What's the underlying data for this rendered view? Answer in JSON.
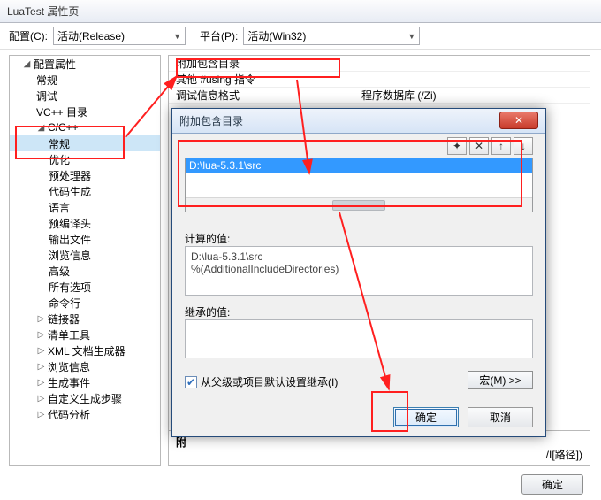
{
  "window": {
    "title": "LuaTest 属性页"
  },
  "config": {
    "label_config": "配置(C):",
    "value_config": "活动(Release)",
    "label_platform": "平台(P):",
    "value_platform": "活动(Win32)"
  },
  "tree": {
    "root": "配置属性",
    "items_lvl2": [
      "常规",
      "调试",
      "VC++ 目录"
    ],
    "cc_root": "C/C++",
    "cc_items": [
      "常规",
      "优化",
      "预处理器",
      "代码生成",
      "语言",
      "预编译头",
      "输出文件",
      "浏览信息",
      "高级",
      "所有选项",
      "命令行"
    ],
    "rest": [
      "链接器",
      "清单工具",
      "XML 文档生成器",
      "浏览信息",
      "生成事件",
      "自定义生成步骤",
      "代码分析"
    ]
  },
  "props": {
    "row1_k": "附加包含目录",
    "row2_k": "其他 #using 指令",
    "row3_k": "调试信息格式",
    "row3_v": "程序数据库 (/Zi)",
    "hint_prefix": "附",
    "hint_suffix": "/I[路径])",
    "btn_ok": "确定"
  },
  "dialog": {
    "title": "附加包含目录",
    "list_selected": "D:\\lua-5.3.1\\src",
    "calc_label": "计算的值:",
    "calc_line1": "D:\\lua-5.3.1\\src",
    "calc_line2": "%(AdditionalIncludeDirectories)",
    "inherit_label": "继承的值:",
    "checkbox_label": "从父级或项目默认设置继承(I)",
    "macro_btn": "宏(M) >>",
    "ok": "确定",
    "cancel": "取消",
    "tool_new": "✦",
    "tool_del": "✕",
    "tool_up": "↑",
    "tool_down": "↓"
  }
}
